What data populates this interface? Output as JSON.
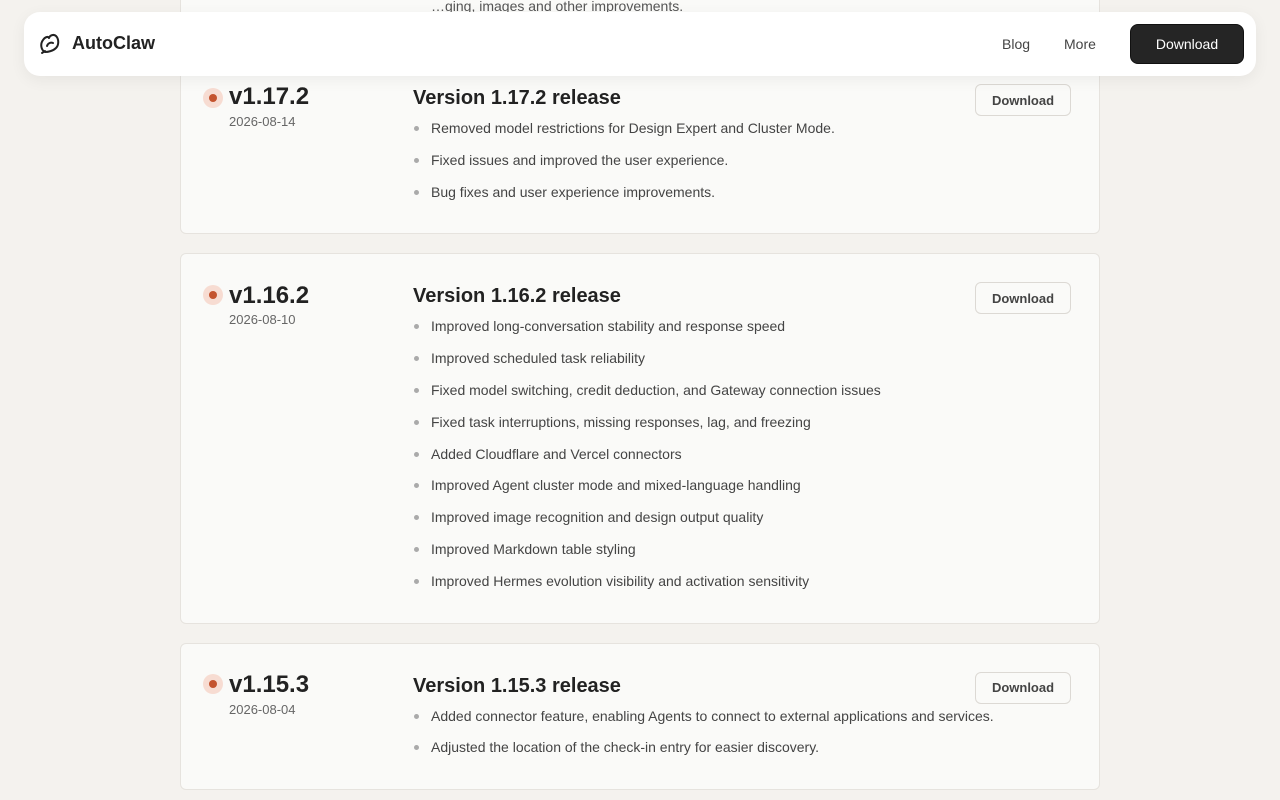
{
  "nav": {
    "brand": "AutoClaw",
    "links": [
      "Blog",
      "More"
    ],
    "download_label": "Download"
  },
  "previous_card_fragment": "…ging, images and other improvements.",
  "releases": [
    {
      "version": "v1.17.2",
      "date": "2026-08-14",
      "title": "Version 1.17.2 release",
      "download_label": "Download",
      "items": [
        "Removed model restrictions for Design Expert and Cluster Mode.",
        "Fixed issues and improved the user experience.",
        "Bug fixes and user experience improvements."
      ]
    },
    {
      "version": "v1.16.2",
      "date": "2026-08-10",
      "title": "Version 1.16.2 release",
      "download_label": "Download",
      "items": [
        "Improved long-conversation stability and response speed",
        "Improved scheduled task reliability",
        "Fixed model switching, credit deduction, and Gateway connection issues",
        "Fixed task interruptions, missing responses, lag, and freezing",
        "Added Cloudflare and Vercel connectors",
        "Improved Agent cluster mode and mixed-language handling",
        "Improved image recognition and design output quality",
        "Improved Markdown table styling",
        "Improved Hermes evolution visibility and activation sensitivity"
      ]
    },
    {
      "version": "v1.15.3",
      "date": "2026-08-04",
      "title": "Version 1.15.3 release",
      "download_label": "Download",
      "items": [
        "Added connector feature, enabling Agents to connect to external applications and services.",
        "Adjusted the location of the check-in entry for easier discovery."
      ]
    }
  ],
  "colors": {
    "accent": "#c4532e",
    "page_bg": "#f4f2ee",
    "card_bg": "#fafaf8",
    "primary_button": "#252525"
  }
}
